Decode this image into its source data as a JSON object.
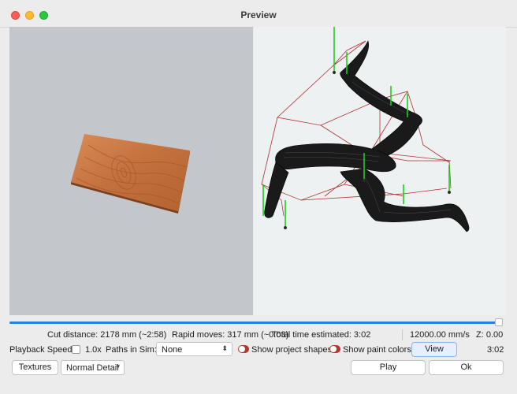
{
  "window": {
    "title": "Preview"
  },
  "stats": {
    "cut_distance": "Cut distance: 2178 mm (~2:58)",
    "rapid_moves": "Rapid moves: 317 mm (~0:03)",
    "total_time": "Total time estimated: 3:02",
    "feed_rate": "12000.00 mm/s",
    "z_value": "Z: 0.00"
  },
  "controls": {
    "playback_speed_label": "Playback Speed",
    "speed_value": "1.0x",
    "paths_in_sim_label": "Paths in Sim:",
    "paths_in_sim_value": "None",
    "show_project_shapes": "Show project shapes",
    "show_paint_colors": "Show paint colors",
    "view_button": "View",
    "elapsed_time": "3:02",
    "textures_button": "Textures",
    "detail_value": "Normal Detail",
    "play_button": "Play",
    "ok_button": "Ok"
  },
  "state": {
    "playback_progress": 1.0,
    "playback_speed_checked": false,
    "show_project_shapes_on": true,
    "show_paint_colors_on": true
  },
  "colors": {
    "accent": "#2a7ee0",
    "toggle_on": "#b8352b",
    "wood": "#c6733f",
    "toolpath": "#1a1a1a",
    "rapid_move": "#b03030",
    "plunge": "#1fcc1f"
  }
}
